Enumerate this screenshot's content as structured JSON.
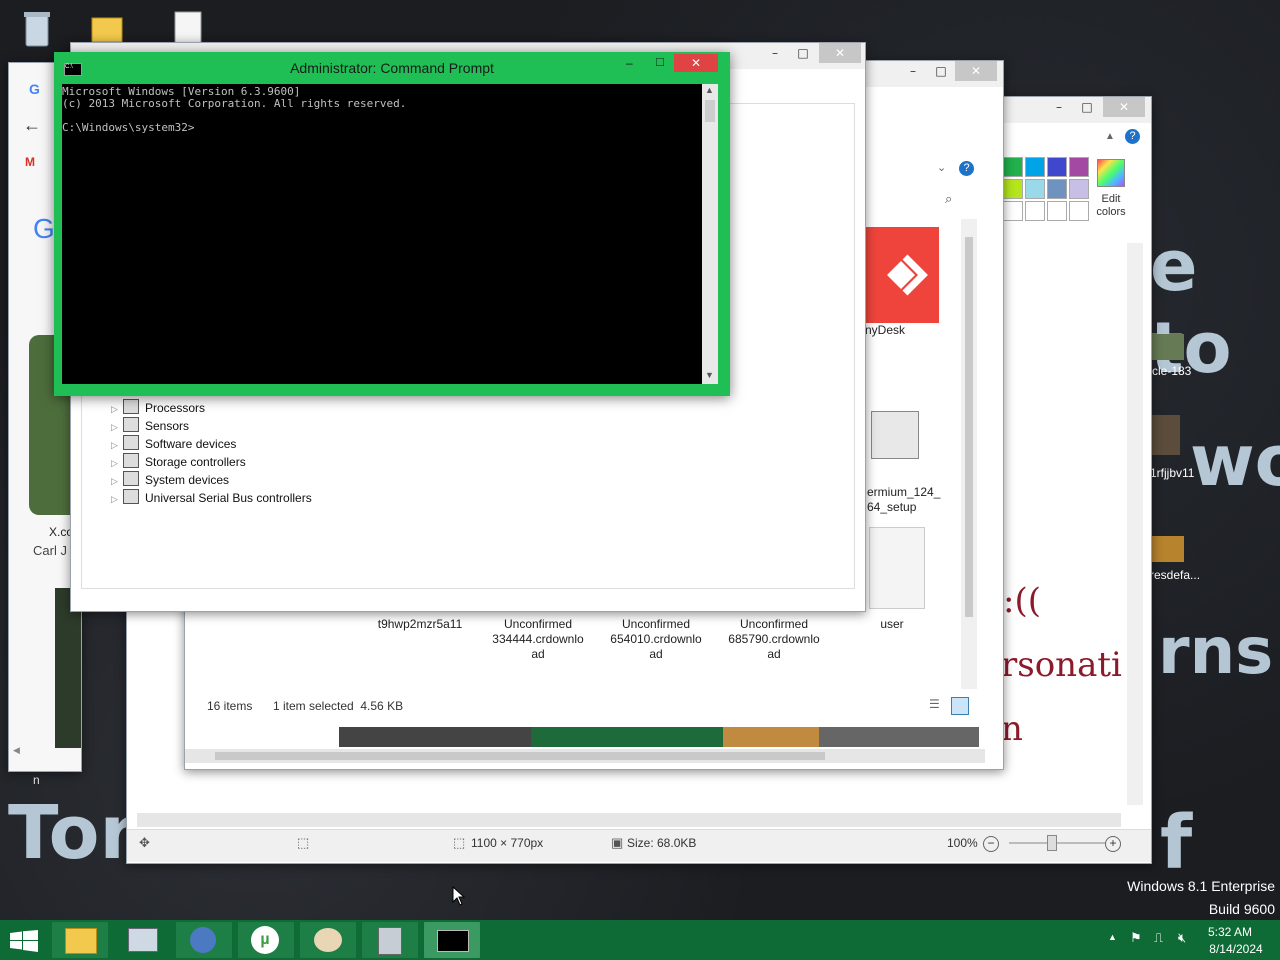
{
  "cmd": {
    "title": "Administrator: Command Prompt",
    "lines": [
      "Microsoft Windows [Version 6.3.9600]",
      "(c) 2013 Microsoft Corporation. All rights reserved.",
      "",
      "C:\\Windows\\system32>"
    ],
    "controls": {
      "min": "–",
      "max": "□",
      "close": "✕"
    }
  },
  "device_manager": {
    "rows": [
      "Processors",
      "Sensors",
      "Software devices",
      "Storage controllers",
      "System devices",
      "Universal Serial Bus controllers"
    ]
  },
  "explorer": {
    "files": [
      {
        "label": "AnyDesk"
      },
      {
        "label": "ermium_124_\n64_setup"
      },
      {
        "label": "user"
      },
      {
        "label": "t9hwp2mzr5a11"
      },
      {
        "label": "Unconfirmed\n334444.crdownlo\nad"
      },
      {
        "label": "Unconfirmed\n654010.crdownlo\nad"
      },
      {
        "label": "Unconfirmed\n685790.crdownlo\nad"
      }
    ],
    "status": {
      "count": "16 items",
      "selection": "1 item selected  4.56 KB"
    }
  },
  "paint": {
    "edit_colors": "Edit\ncolors",
    "status": {
      "dimensions": "1100 × 770px",
      "size": "Size: 68.0KB",
      "zoom": "100%"
    },
    "swatches": [
      "#22b14c",
      "#00a2e8",
      "#3f48cc",
      "#a349a4",
      "#b5e61d",
      "#99d9ea",
      "#7092be",
      "#c8bfe7",
      "#ffffff",
      "#ffffff",
      "#ffffff",
      "#ffffff"
    ]
  },
  "desktop_labels": [
    "cle-183",
    "1rfjjbv11",
    "resdefa..."
  ],
  "browser": {
    "link": "X.co",
    "name": "Carl J"
  },
  "big_text": [
    "e to",
    "wo",
    "rns",
    "Tor",
    "f"
  ],
  "red_text": [
    ":((",
    "rsonati",
    "n"
  ],
  "watermark": {
    "line1": "Windows 8.1 Enterprise",
    "line2": "Build 9600"
  },
  "clock": {
    "time": "5:32 AM",
    "date": "8/14/2024"
  },
  "small_n": "n",
  "colors": {
    "cmd_border": "#1fbf55",
    "taskbar": "#0f6b35",
    "anydesk": "#ef443b"
  }
}
